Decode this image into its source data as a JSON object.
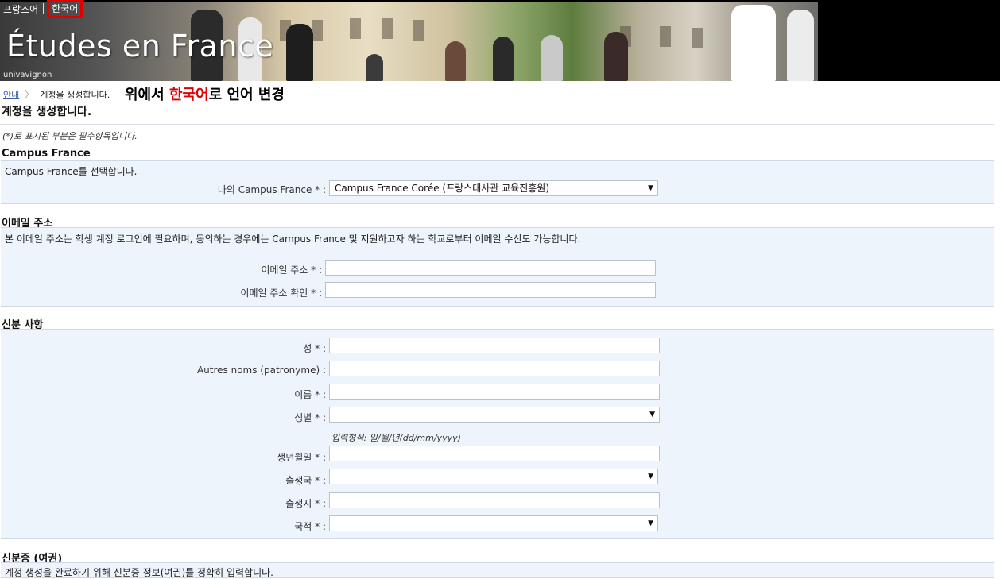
{
  "header": {
    "lang_fr": "프랑스어",
    "lang_ko": "한국어",
    "site_title": "Études en France",
    "site_sub": "univavignon"
  },
  "breadcrumb": {
    "home": "안내",
    "current": "계정을 생성합니다."
  },
  "annotation": {
    "before": "위에서 ",
    "highlight": "한국어",
    "after": "로 언어 변경"
  },
  "page_title": "계정을 생성합니다.",
  "required_note": "(*)로 표시된 부분은 필수항목입니다.",
  "campus": {
    "title": "Campus France",
    "desc": "Campus France를 선택합니다.",
    "label": "나의 Campus France * :",
    "value": "Campus France Corée (프랑스대사관 교육진흥원)"
  },
  "email": {
    "title": "이메일 주소",
    "desc": "본 이메일 주소는 학생 계정 로그인에 필요하며, 동의하는 경우에는 Campus France 및 지원하고자 하는 학교로부터 이메일 수신도 가능합니다.",
    "email_label": "이메일 주소 * :",
    "email_value": "",
    "confirm_label": "이메일 주소 확인 * :",
    "confirm_value": ""
  },
  "identity": {
    "title": "신분 사항",
    "surname_label": "성 * :",
    "other_names_label": "Autres noms (patronyme) :",
    "firstname_label": "이름 * :",
    "gender_label": "성별 * :",
    "date_hint": "입력형식: 일/월/년(dd/mm/yyyy)",
    "birthdate_label": "생년월일 * :",
    "birth_country_label": "출생국 * :",
    "birth_place_label": "출생지 * :",
    "nationality_label": "국적 * :"
  },
  "passport": {
    "title": "신분증 (여권)",
    "desc": "계정 생성을 완료하기 위해 신분증 정보(여권)를 정확히 입력합니다."
  },
  "colors": {
    "accent_red": "#e00000",
    "panel_bg": "#eef4fc",
    "link": "#3a5fa8"
  }
}
